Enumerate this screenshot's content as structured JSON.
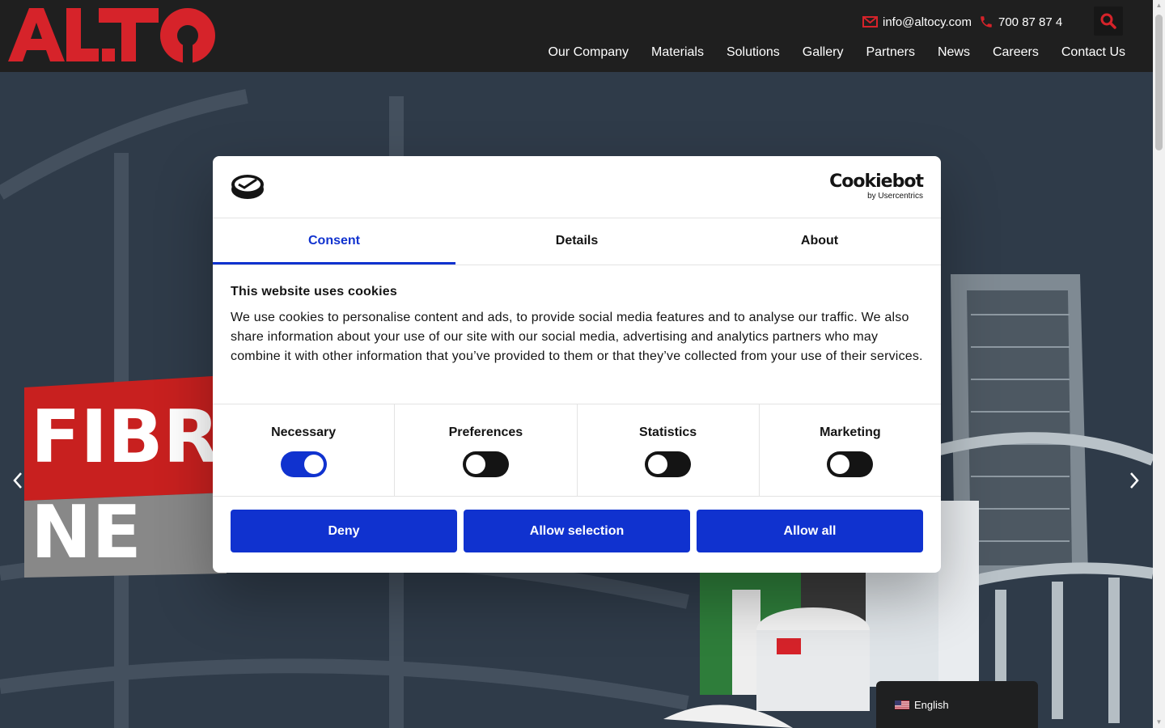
{
  "header": {
    "logo_text": "ALTO",
    "email": "info@altocy.com",
    "phone": "700 87 87 4",
    "nav": [
      "Our Company",
      "Materials",
      "Solutions",
      "Gallery",
      "Partners",
      "News",
      "Careers",
      "Contact Us"
    ],
    "accent_color": "#d6232a"
  },
  "hero": {
    "banner_line1": "FIBR",
    "banner_line2": "NE",
    "prev_icon": "chevron-left-icon",
    "next_icon": "chevron-right-icon"
  },
  "cookie_dialog": {
    "brand": "Cookiebot",
    "brand_sub": "by Usercentrics",
    "tabs": [
      "Consent",
      "Details",
      "About"
    ],
    "active_tab": "Consent",
    "title": "This website uses cookies",
    "body": "We use cookies to personalise content and ads, to provide social media features and to analyse our traffic. We also share information about your use of our site with our social media, advertising and analytics partners who may combine it with other information that you’ve provided to them or that they’ve collected from your use of their services.",
    "categories": [
      {
        "label": "Necessary",
        "enabled": true
      },
      {
        "label": "Preferences",
        "enabled": false
      },
      {
        "label": "Statistics",
        "enabled": false
      },
      {
        "label": "Marketing",
        "enabled": false
      }
    ],
    "buttons": {
      "deny": "Deny",
      "allow_selection": "Allow selection",
      "allow_all": "Allow all"
    },
    "accent_color": "#1032cf"
  },
  "language": {
    "label": "English"
  }
}
